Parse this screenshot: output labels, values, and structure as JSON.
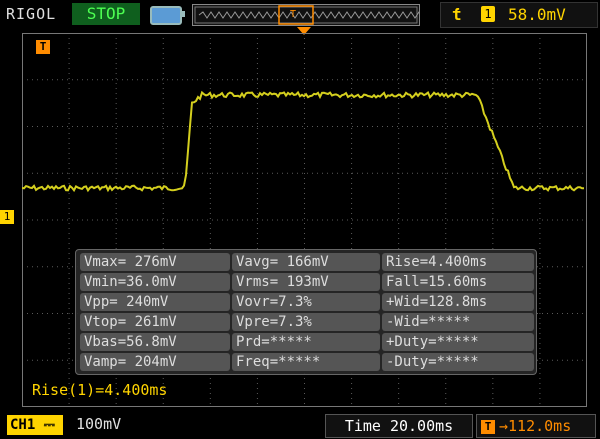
{
  "header": {
    "brand": "RIGOL",
    "run_state": "STOP",
    "trigger_channel": "1",
    "trigger_level": "58.0mV",
    "trigger_edge_icon": "rising-edge-icon",
    "accent_trigger": "#ffd400",
    "accent_run": "#4dff52"
  },
  "markers": {
    "time_marker": "T",
    "channel_marker": "1"
  },
  "measurements": {
    "rows": [
      [
        "Vmax= 276mV",
        "Vavg= 166mV",
        "Rise=4.400ms"
      ],
      [
        "Vmin=36.0mV",
        "Vrms= 193mV",
        "Fall=15.60ms"
      ],
      [
        "Vpp= 240mV",
        "Vovr=7.3%",
        "+Wid=128.8ms"
      ],
      [
        "Vtop= 261mV",
        "Vpre=7.3%",
        "-Wid=*****"
      ],
      [
        "Vbas=56.8mV",
        "Prd=*****",
        "+Duty=*****"
      ],
      [
        "Vamp= 204mV",
        "Freq=*****",
        "-Duty=*****"
      ]
    ]
  },
  "status": {
    "active_measurement": "Rise(1)=4.400ms"
  },
  "footer": {
    "channel_label": "CH1",
    "channel_scale": "100mV",
    "timebase": "Time 20.00ms",
    "trigger_offset": "112.0ms"
  },
  "waveform": {
    "color": "#d4cf1e",
    "low_level_mV": 56.8,
    "high_level_mV": 261
  }
}
